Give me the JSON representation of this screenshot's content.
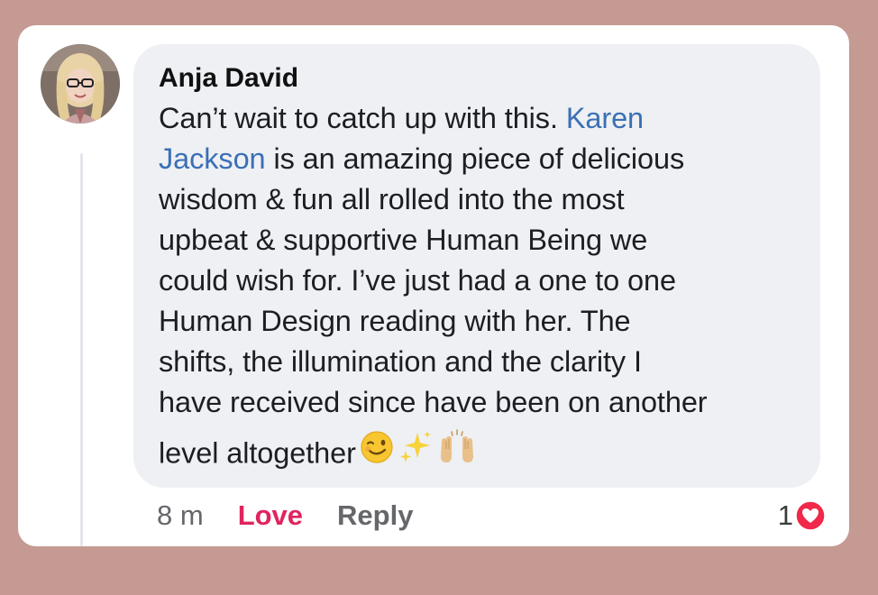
{
  "comment": {
    "author": "Anja David",
    "body_lines": [
      "Can’t wait to catch up with this. ",
      " is an amazing piece of delicious",
      "wisdom & fun all rolled into the most",
      "upbeat & supportive Human Being we",
      "could wish for. I’ve just had a one to one",
      "Human Design reading with her. The",
      "shifts, the illumination and the clarity I",
      "have received since have been on another",
      "level altogether"
    ],
    "mention_part1": "Karen",
    "mention_part2": "Jackson",
    "emojis": [
      "winking-face",
      "sparkles",
      "raising-hands"
    ]
  },
  "actions": {
    "time": "8 m",
    "love_label": "Love",
    "reply_label": "Reply"
  },
  "reactions": {
    "count": "1",
    "icon": "heart-reaction-icon"
  },
  "colors": {
    "background": "#c49a92",
    "bubble": "#eef0f3",
    "mention": "#3b6fb6",
    "love": "#e0245e",
    "heart_badge": "#f0284a"
  }
}
